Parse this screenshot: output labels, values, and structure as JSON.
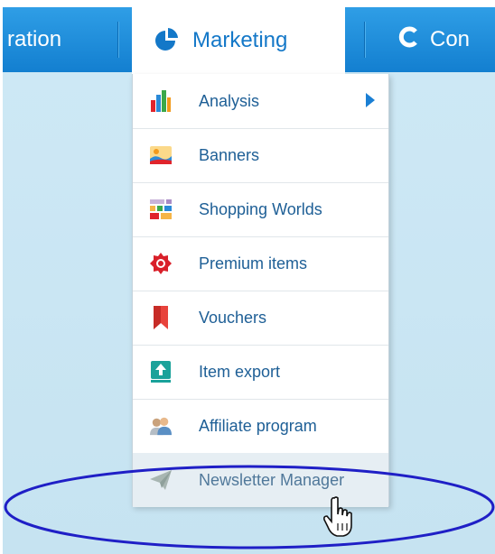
{
  "nav": {
    "left_item": "ration",
    "active_item": "Marketing",
    "right_item": "Con"
  },
  "menu": {
    "items": [
      {
        "label": "Analysis",
        "icon": "bar-chart-icon",
        "has_submenu": true
      },
      {
        "label": "Banners",
        "icon": "landscape-image-icon"
      },
      {
        "label": "Shopping Worlds",
        "icon": "tiles-layout-icon"
      },
      {
        "label": "Premium items",
        "icon": "premium-badge-icon"
      },
      {
        "label": "Vouchers",
        "icon": "bookmark-ribbon-icon"
      },
      {
        "label": "Item export",
        "icon": "upload-arrow-icon"
      },
      {
        "label": "Affiliate program",
        "icon": "users-icon"
      },
      {
        "label": "Newsletter Manager",
        "icon": "paper-plane-icon",
        "hovered": true
      }
    ]
  },
  "annotation": {
    "shape": "ellipse",
    "color": "#1f1fc6"
  },
  "colors": {
    "nav_blue": "#2196e0",
    "link_blue": "#1e5f96",
    "content_bg": "#c9e6f3"
  }
}
